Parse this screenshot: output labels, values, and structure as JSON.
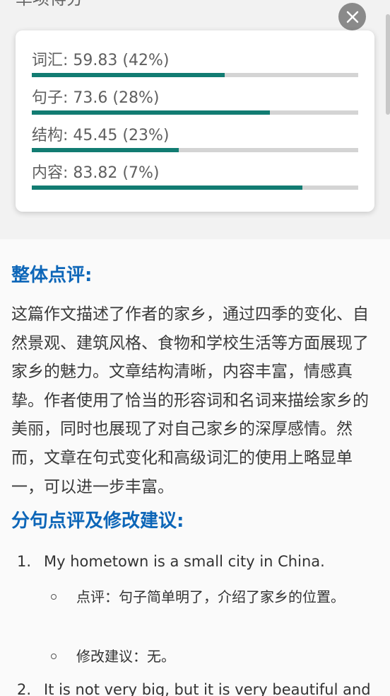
{
  "header": {
    "cut_title": "单项得分"
  },
  "scores": [
    {
      "label": "词汇: 59.83 (42%)",
      "fill": 0.59
    },
    {
      "label": "句子: 73.6 (28%)",
      "fill": 0.73
    },
    {
      "label": "结构: 45.45 (23%)",
      "fill": 0.45
    },
    {
      "label": "内容: 83.82 (7%)",
      "fill": 0.83
    }
  ],
  "overall": {
    "heading": "整体点评:",
    "text": "这篇作文描述了作者的家乡，通过四季的变化、自然景观、建筑风格、食物和学校生活等方面展现了家乡的魅力。文章结构清晰，内容丰富，情感真挚。作者使用了恰当的形容词和名词来描绘家乡的美丽，同时也展现了对自己家乡的深厚感情。然而，文章在句式变化和高级词汇的使用上略显单一，可以进一步丰富。"
  },
  "sentences": {
    "heading": "分句点评及修改建议:",
    "items": [
      {
        "number": "1.",
        "text": "My hometown is a small city in China.",
        "comment": "点评：句子简单明了，介绍了家乡的位置。",
        "suggestion": "修改建议：无。"
      },
      {
        "number": "2.",
        "text": "It is not very big, but it is very beautiful and"
      }
    ]
  },
  "colors": {
    "accent": "#127c72",
    "heading": "#0d66b8",
    "track": "#d4d4d4"
  }
}
